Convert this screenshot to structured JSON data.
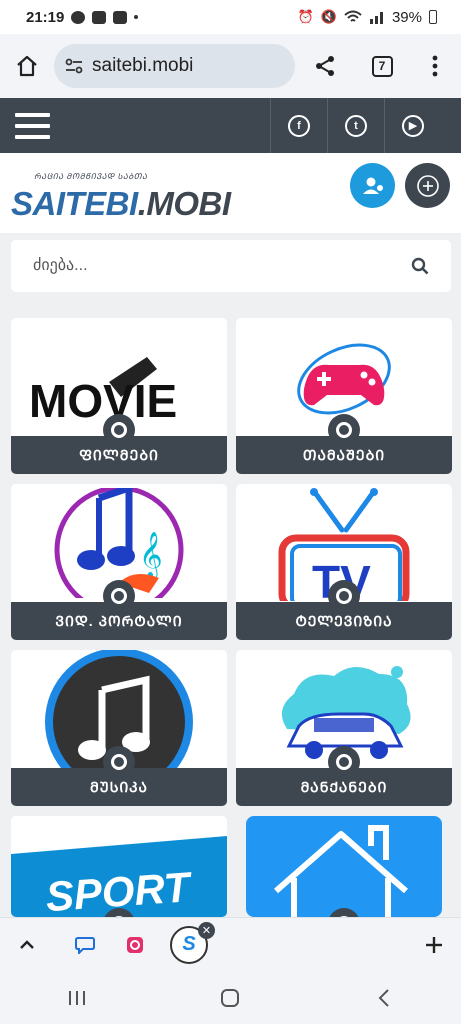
{
  "status_bar": {
    "time": "21:19",
    "battery": "39%"
  },
  "browser": {
    "url": "saitebi.mobi",
    "tab_count": "7"
  },
  "site": {
    "logo_text_blue": "SAITEBI",
    "logo_text_dark": ".MOBI",
    "logo_tagline": "ᲠᲐᲪᲘᲐ ᲛᲝᲛᲬᲘᲕᲐᲓ ᲡᲐᲑᲗᲐ",
    "social": [
      "facebook-icon",
      "twitter-icon",
      "youtube-icon"
    ],
    "search_placeholder": "ძიება..."
  },
  "categories": [
    {
      "label": "ᲤᲘᲚᲛᲔᲑᲘ",
      "art_text": "MOVIE",
      "icon": "movie-film-icon"
    },
    {
      "label": "ᲗᲐᲛᲐᲨᲔᲑᲘ",
      "icon": "gamepad-icon"
    },
    {
      "label": "ᲕᲘᲓ. ᲞᲝᲠᲢᲐᲚᲘ",
      "icon": "music-notes-icon"
    },
    {
      "label": "ᲢᲔᲚᲔᲕᲘᲖᲘᲐ",
      "art_text": "TV",
      "icon": "tv-icon"
    },
    {
      "label": "ᲛᲣᲡᲘᲙᲐ",
      "icon": "music-note-icon"
    },
    {
      "label": "ᲛᲐᲜᲥᲐᲜᲔᲑᲘ",
      "icon": "car-icon"
    },
    {
      "label": "",
      "art_text": "SPORT",
      "icon": "sport-icon"
    },
    {
      "label": "",
      "icon": "house-icon"
    }
  ],
  "colors": {
    "dark": "#3e4650",
    "accent": "#1e9bdc"
  }
}
